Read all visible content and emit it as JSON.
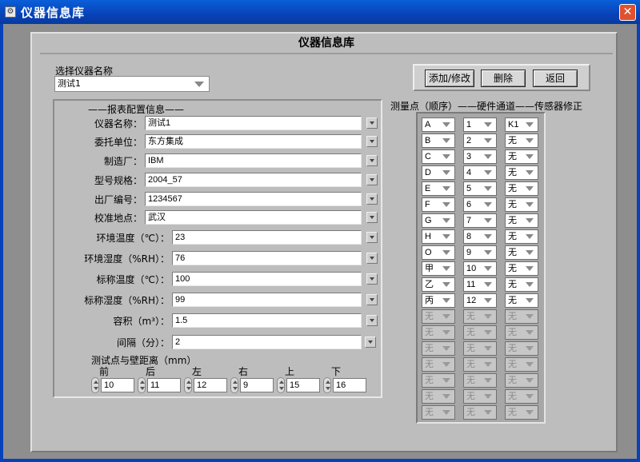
{
  "window": {
    "title": "仪器信息库",
    "close": "✕"
  },
  "header": {
    "title": "仪器信息库"
  },
  "instrument_select": {
    "label": "选择仪器名称",
    "value": "测试1"
  },
  "buttons": {
    "add_edit": "添加/修改",
    "delete": "删除",
    "back": "返回"
  },
  "report": {
    "section_title": "——报表配置信息——",
    "fields": [
      {
        "label": "仪器名称：",
        "value": "测试1"
      },
      {
        "label": "委托单位：",
        "value": "东方集成"
      },
      {
        "label": "制造厂：",
        "value": "IBM"
      },
      {
        "label": "型号规格：",
        "value": "2004_57"
      },
      {
        "label": "出厂编号：",
        "value": "1234567"
      },
      {
        "label": "校准地点：",
        "value": "武汉"
      },
      {
        "label": "环境温度（℃）：",
        "value": "23"
      },
      {
        "label": "环境湿度（%RH）：",
        "value": "76"
      },
      {
        "label": "标称温度（℃）：",
        "value": "100"
      },
      {
        "label": "标称湿度（%RH）：",
        "value": "99"
      },
      {
        "label": "容积（m³）：",
        "value": "1.5"
      },
      {
        "label": "间隔（分）：",
        "value": "2"
      }
    ],
    "distance": {
      "title": "测试点与壁距离（mm）",
      "items": [
        {
          "label": "前",
          "value": "10"
        },
        {
          "label": "后",
          "value": "11"
        },
        {
          "label": "左",
          "value": "12"
        },
        {
          "label": "右",
          "value": "9"
        },
        {
          "label": "上",
          "value": "15"
        },
        {
          "label": "下",
          "value": "16"
        }
      ]
    }
  },
  "measure": {
    "title": "测量点（顺序）——硬件通道——传感器修正",
    "rows": [
      {
        "p": "A",
        "c": "1",
        "s": "K1",
        "en": true
      },
      {
        "p": "B",
        "c": "2",
        "s": "无",
        "en": true
      },
      {
        "p": "C",
        "c": "3",
        "s": "无",
        "en": true
      },
      {
        "p": "D",
        "c": "4",
        "s": "无",
        "en": true
      },
      {
        "p": "E",
        "c": "5",
        "s": "无",
        "en": true
      },
      {
        "p": "F",
        "c": "6",
        "s": "无",
        "en": true
      },
      {
        "p": "G",
        "c": "7",
        "s": "无",
        "en": true
      },
      {
        "p": "H",
        "c": "8",
        "s": "无",
        "en": true
      },
      {
        "p": "O",
        "c": "9",
        "s": "无",
        "en": true
      },
      {
        "p": "甲",
        "c": "10",
        "s": "无",
        "en": true
      },
      {
        "p": "乙",
        "c": "11",
        "s": "无",
        "en": true
      },
      {
        "p": "丙",
        "c": "12",
        "s": "无",
        "en": true
      },
      {
        "p": "无",
        "c": "无",
        "s": "无",
        "en": false
      },
      {
        "p": "无",
        "c": "无",
        "s": "无",
        "en": false
      },
      {
        "p": "无",
        "c": "无",
        "s": "无",
        "en": false
      },
      {
        "p": "无",
        "c": "无",
        "s": "无",
        "en": false
      },
      {
        "p": "无",
        "c": "无",
        "s": "无",
        "en": false
      },
      {
        "p": "无",
        "c": "无",
        "s": "无",
        "en": false
      },
      {
        "p": "无",
        "c": "无",
        "s": "无",
        "en": false
      }
    ]
  }
}
